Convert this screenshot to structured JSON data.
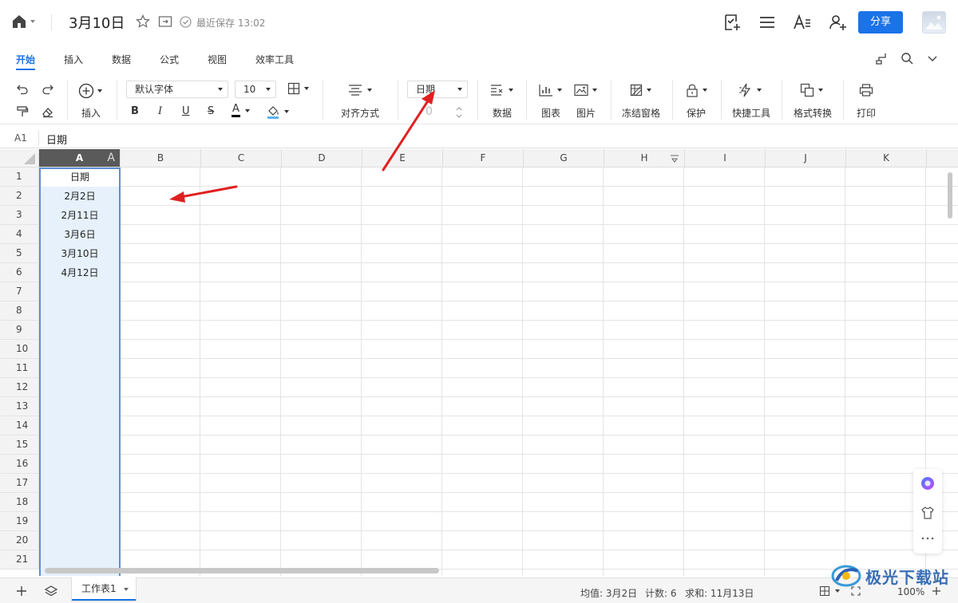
{
  "titlebar": {
    "title": "3月10日",
    "save_status": "最近保存 13:02",
    "share_label": "分享"
  },
  "tabs": [
    {
      "label": "开始",
      "active": true
    },
    {
      "label": "插入"
    },
    {
      "label": "数据"
    },
    {
      "label": "公式"
    },
    {
      "label": "视图"
    },
    {
      "label": "效率工具"
    }
  ],
  "toolbar": {
    "insert_label": "插入",
    "font_name": "默认字体",
    "font_size": "10",
    "bold": "B",
    "italic": "I",
    "underline": "U",
    "strike": "S",
    "font_color_letter": "A",
    "align_label": "对齐方式",
    "number_format": "日期",
    "decimal_value": "0",
    "data_label": "数据",
    "chart_label": "图表",
    "picture_label": "图片",
    "freeze_label": "冻结窗格",
    "protect_label": "保护",
    "quicktool_label": "快捷工具",
    "convert_label": "格式转换",
    "print_label": "打印"
  },
  "formula_bar": {
    "cell_ref": "A1",
    "value": "日期"
  },
  "grid": {
    "columns": [
      "A",
      "B",
      "C",
      "D",
      "E",
      "F",
      "G",
      "H",
      "I",
      "J",
      "K"
    ],
    "rows": [
      "1",
      "2",
      "3",
      "4",
      "5",
      "6",
      "7",
      "8",
      "9",
      "10",
      "11",
      "12",
      "13",
      "14",
      "15",
      "16",
      "17",
      "18",
      "19",
      "20",
      "21"
    ],
    "column_a": [
      "日期",
      "2月2日",
      "2月11日",
      "3月6日",
      "3月10日",
      "4月12日"
    ],
    "col_a_marker": "A"
  },
  "statusbar": {
    "sheet_name": "工作表1",
    "average": "均值: 3月2日",
    "count": "计数: 6",
    "sum": "求和: 11月13日",
    "zoom": "100%"
  },
  "watermark": {
    "text": "极光下载站"
  },
  "colors": {
    "accent": "#1a73e8",
    "selection_fill": "#e6f1fc",
    "selection_border": "#5d8fd6",
    "annotation_arrow": "#e02020"
  }
}
